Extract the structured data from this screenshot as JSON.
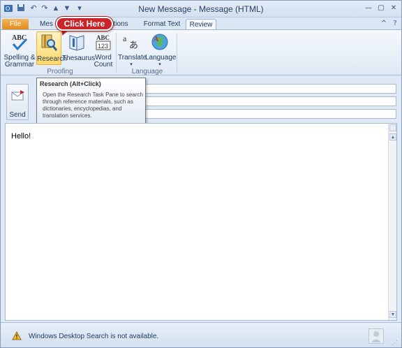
{
  "window": {
    "title": "New Message  -  Message (HTML)"
  },
  "qat": {
    "items": [
      "save-icon",
      "undo-icon",
      "redo-icon",
      "up-icon",
      "down-icon",
      "customize-icon"
    ]
  },
  "tabs": {
    "file": "File",
    "message": "Mes",
    "options": "ptions",
    "format_text": "Format Text",
    "review": "Review"
  },
  "callout": {
    "text": "Click Here"
  },
  "ribbon": {
    "spelling_line1": "Spelling &",
    "spelling_line2": "Grammar",
    "research": "Research",
    "thesaurus": "Thesaurus",
    "wordcount_line1": "Word",
    "wordcount_line2": "Count",
    "translate": "Translate",
    "language": "Language",
    "group_proofing": "Proofing",
    "group_language": "Language",
    "abc_icon_text": "ABC",
    "wordcount_icon_text": "ABC",
    "wordcount_icon_num": "123"
  },
  "compose": {
    "send_label": "Send"
  },
  "tooltip": {
    "title": "Research (Alt+Click)",
    "body": "Open the Research Task Pane to search through reference materials, such as dictionaries, encyclopedias, and translation services."
  },
  "message_body": {
    "text": "Hello!"
  },
  "statusbar": {
    "text": "Windows Desktop Search is not available."
  },
  "colors": {
    "file_tab": "#e08a1a",
    "callout": "#c8242a",
    "highlight": "#ffd86a"
  }
}
